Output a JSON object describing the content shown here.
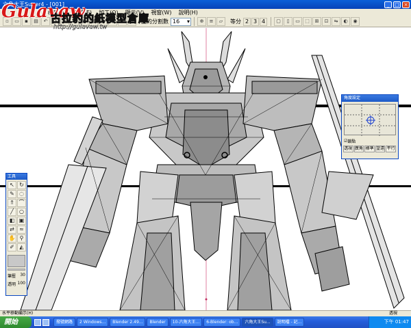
{
  "window": {
    "title": "六角大王Super4 - [001]"
  },
  "menu": {
    "items": [
      "檔案(F)",
      "編輯(E)",
      "加工(O)",
      "顯示(V)",
      "視窗(W)",
      "說明(H)"
    ]
  },
  "toolbar": {
    "subdivision_label": "圓的分割數",
    "subdivision_value": "16",
    "equal_label": "等分",
    "equal_options": [
      "2",
      "3",
      "4"
    ]
  },
  "watermark": {
    "logo_text": "Gulavaw",
    "site_name": "古拉豹的紙模型倉庫",
    "url": "http://gulavaw.tw"
  },
  "palette": {
    "title": "工具",
    "tools": [
      "select-arrow",
      "rotate",
      "knife",
      "lasso",
      "extrude",
      "bend",
      "line",
      "circle",
      "face",
      "cube",
      "mirror",
      "warp",
      "hand",
      "zoom",
      "brush",
      "bucket"
    ],
    "pen_label": "筆壓",
    "pen_value": "30",
    "opacity_label": "透明",
    "opacity_value": "100"
  },
  "angle_panel": {
    "title": "角度設定",
    "checkbox_label": "鎖點",
    "checkbox_checked": true,
    "buttons": [
      "透視",
      "廣角",
      "標準",
      "望遠",
      "平行"
    ]
  },
  "statusbar": {
    "left": "水平移動顯示(H)",
    "right": "透視"
  },
  "taskbar": {
    "start": "開始",
    "tasks": [
      {
        "label": "撥號網路",
        "active": false
      },
      {
        "label": "2 Windows...",
        "active": false
      },
      {
        "label": "Blender 2.49...",
        "active": false
      },
      {
        "label": "Blender",
        "active": false
      },
      {
        "label": "10-六角大王...",
        "active": false
      },
      {
        "label": "6-Blender: ob...",
        "active": false
      },
      {
        "label": "六角大王Su...",
        "active": true
      },
      {
        "label": "說明檔 - 記...",
        "active": false
      }
    ],
    "clock": "下午 01:47"
  },
  "colors": {
    "accent": "#0a46c0",
    "logo_red": "#d81818"
  }
}
